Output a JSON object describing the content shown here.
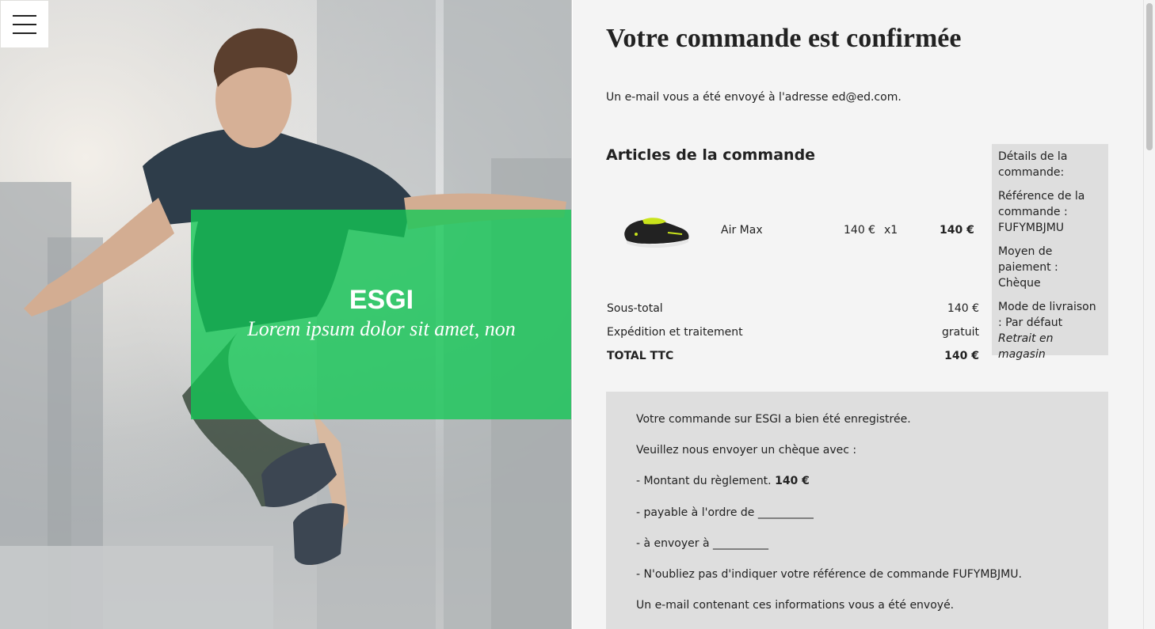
{
  "hero": {
    "title": "ESGI",
    "subtitle": "Lorem ipsum dolor sit amet, non"
  },
  "menu": {
    "icon": "hamburger-menu-icon"
  },
  "order": {
    "title": "Votre commande est confirmée",
    "email_note": "Un e-mail vous a été envoyé à l'adresse ed@ed.com.",
    "articles_heading": "Articles de la commande",
    "items": [
      {
        "name": "Air Max",
        "price": "140 €",
        "qty": "x1",
        "total": "140 €",
        "image": "sneaker-image"
      }
    ],
    "totals": {
      "subtotal_label": "Sous-total",
      "subtotal_value": "140 €",
      "shipping_label": "Expédition et traitement",
      "shipping_value": "gratuit",
      "total_label": "TOTAL TTC",
      "total_value": "140 €"
    },
    "details": {
      "heading": "Détails de la commande:",
      "reference": "Référence de la commande : FUFYMBJMU",
      "payment": "Moyen de paiement : Chèque",
      "delivery": "Mode de livraison : Par défaut",
      "delivery_note": "Retrait en magasin"
    },
    "notice": {
      "line1": "Votre commande sur ESGI a bien été enregistrée.",
      "line2": "Veuillez nous envoyer un chèque avec :",
      "line3_prefix": "- Montant du règlement. ",
      "line3_amount": "140 €",
      "line4": "- payable à l'ordre de __________",
      "line5": "- à envoyer à __________",
      "line6": "- N'oubliez pas d'indiquer votre référence de commande FUFYMBJMU.",
      "line7": "Un e-mail contenant ces informations vous a été envoyé."
    }
  },
  "colors": {
    "accent_green": "#12c855",
    "panel_gray": "#dedede",
    "content_bg": "#f4f4f4"
  }
}
